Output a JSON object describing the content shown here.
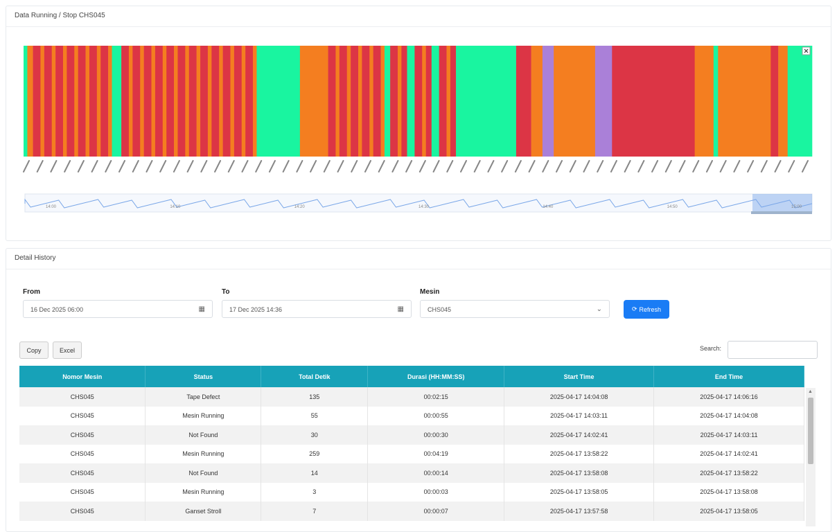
{
  "top_card": {
    "title": "Data Running / Stop CHS045"
  },
  "chart_data": {
    "type": "timeline",
    "colors": {
      "running": "#19f5a0",
      "stop": "#f47e20",
      "defect": "#dc3545",
      "other": "#aa80d8"
    },
    "segments": [
      [
        "running",
        1
      ],
      [
        "stop",
        1.5
      ],
      [
        "defect",
        2
      ],
      [
        "stop",
        1
      ],
      [
        "defect",
        2
      ],
      [
        "stop",
        1
      ],
      [
        "defect",
        2
      ],
      [
        "stop",
        1
      ],
      [
        "defect",
        2
      ],
      [
        "stop",
        1
      ],
      [
        "defect",
        2
      ],
      [
        "stop",
        1
      ],
      [
        "defect",
        2
      ],
      [
        "stop",
        1
      ],
      [
        "defect",
        2
      ],
      [
        "stop",
        1
      ],
      [
        "running",
        2.5
      ],
      [
        "defect",
        2
      ],
      [
        "stop",
        1
      ],
      [
        "defect",
        2
      ],
      [
        "stop",
        1
      ],
      [
        "defect",
        2
      ],
      [
        "stop",
        1
      ],
      [
        "defect",
        2
      ],
      [
        "stop",
        1
      ],
      [
        "defect",
        2
      ],
      [
        "stop",
        1
      ],
      [
        "defect",
        2
      ],
      [
        "stop",
        1
      ],
      [
        "defect",
        2
      ],
      [
        "stop",
        1
      ],
      [
        "defect",
        2
      ],
      [
        "stop",
        1
      ],
      [
        "defect",
        2
      ],
      [
        "stop",
        1
      ],
      [
        "defect",
        2
      ],
      [
        "stop",
        1
      ],
      [
        "defect",
        2
      ],
      [
        "stop",
        1
      ],
      [
        "defect",
        2
      ],
      [
        "stop",
        1
      ],
      [
        "running",
        11.5
      ],
      [
        "stop",
        7.5
      ],
      [
        "defect",
        2
      ],
      [
        "stop",
        1
      ],
      [
        "defect",
        2
      ],
      [
        "stop",
        1
      ],
      [
        "defect",
        2
      ],
      [
        "stop",
        1
      ],
      [
        "defect",
        2
      ],
      [
        "stop",
        1
      ],
      [
        "defect",
        2
      ],
      [
        "stop",
        1
      ],
      [
        "running",
        1.5
      ],
      [
        "defect",
        2
      ],
      [
        "stop",
        1
      ],
      [
        "defect",
        1.5
      ],
      [
        "running",
        2
      ],
      [
        "defect",
        2
      ],
      [
        "stop",
        1
      ],
      [
        "defect",
        1.5
      ],
      [
        "running",
        2
      ],
      [
        "defect",
        2
      ],
      [
        "stop",
        1
      ],
      [
        "defect",
        1.5
      ],
      [
        "running",
        16
      ],
      [
        "defect",
        4
      ],
      [
        "stop",
        3
      ],
      [
        "other",
        3
      ],
      [
        "stop",
        11
      ],
      [
        "other",
        4.5
      ],
      [
        "defect",
        22
      ],
      [
        "stop",
        5
      ],
      [
        "running",
        1.2
      ],
      [
        "stop",
        14
      ],
      [
        "defect",
        2
      ],
      [
        "stop",
        2.5
      ],
      [
        "running",
        6.5
      ]
    ],
    "navigator_ticks": [
      "14:00",
      "14:10",
      "14:20",
      "14:30",
      "14:40",
      "14:50",
      "15:00"
    ]
  },
  "bottom_card": {
    "title": "Detail History"
  },
  "filters": {
    "from_label": "From",
    "from_value": "16 Dec 2025 06:00",
    "to_label": "To",
    "to_value": "17 Dec 2025 14:36",
    "mesin_label": "Mesin",
    "mesin_value": "CHS045",
    "refresh_label": "Refresh"
  },
  "table_controls": {
    "copy_label": "Copy",
    "excel_label": "Excel",
    "search_label": "Search:"
  },
  "table": {
    "columns": [
      "Nomor Mesin",
      "Status",
      "Total Detik",
      "Durasi (HH:MM:SS)",
      "Start Time",
      "End Time"
    ],
    "rows": [
      [
        "CHS045",
        "Tape Defect",
        "135",
        "00:02:15",
        "2025-04-17 14:04:08",
        "2025-04-17 14:06:16"
      ],
      [
        "CHS045",
        "Mesin Running",
        "55",
        "00:00:55",
        "2025-04-17 14:03:11",
        "2025-04-17 14:04:08"
      ],
      [
        "CHS045",
        "Not Found",
        "30",
        "00:00:30",
        "2025-04-17 14:02:41",
        "2025-04-17 14:03:11"
      ],
      [
        "CHS045",
        "Mesin Running",
        "259",
        "00:04:19",
        "2025-04-17 13:58:22",
        "2025-04-17 14:02:41"
      ],
      [
        "CHS045",
        "Not Found",
        "14",
        "00:00:14",
        "2025-04-17 13:58:08",
        "2025-04-17 13:58:22"
      ],
      [
        "CHS045",
        "Mesin Running",
        "3",
        "00:00:03",
        "2025-04-17 13:58:05",
        "2025-04-17 13:58:08"
      ],
      [
        "CHS045",
        "Ganset Stroll",
        "7",
        "00:00:07",
        "2025-04-17 13:57:58",
        "2025-04-17 13:58:05"
      ]
    ]
  }
}
